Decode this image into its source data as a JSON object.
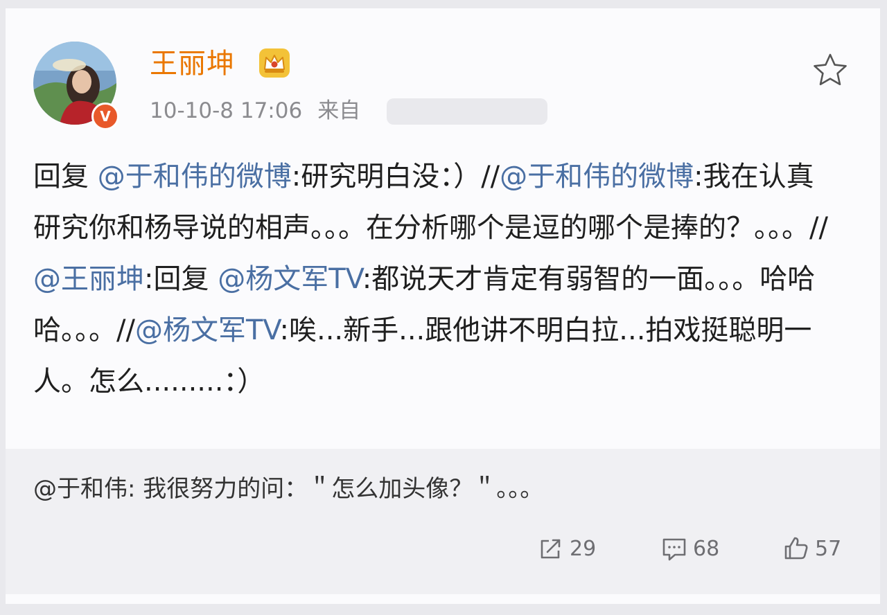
{
  "post": {
    "author": "王丽坤",
    "verified_mark": "V",
    "timestamp": "10-10-8 17:06",
    "source_label": "来自",
    "body": [
      {
        "text": "回复 ",
        "mention": false
      },
      {
        "text": "@于和伟的微博",
        "mention": true
      },
      {
        "text": ":研究明白没：）//",
        "mention": false
      },
      {
        "text": "@于和伟的微博",
        "mention": true
      },
      {
        "text": ":我在认真研究你和杨导说的相声。。。在分析哪个是逗的哪个是捧的？。。。//",
        "mention": false
      },
      {
        "text": "@王丽坤",
        "mention": true
      },
      {
        "text": ":回复 ",
        "mention": false
      },
      {
        "text": "@杨文军TV",
        "mention": true
      },
      {
        "text": ":都说天才肯定有弱智的一面。。。哈哈哈。。。//",
        "mention": false
      },
      {
        "text": "@杨文军TV",
        "mention": true
      },
      {
        "text": ":唉...新手...跟他讲不明白拉...拍戏挺聪明一人。怎么.........：）",
        "mention": false
      }
    ]
  },
  "comment": {
    "text": "@于和伟: 我很努力的问：＂怎么加头像？＂。。。"
  },
  "actions": {
    "repost_count": "29",
    "comment_count": "68",
    "like_count": "57"
  },
  "colors": {
    "username": "#ea7700",
    "mention": "#4a6fa3",
    "verified_badge": "#e8592a",
    "meta": "#8b8b8f"
  },
  "icons": {
    "favorite": "star-icon",
    "vip": "crown-icon",
    "repost": "repost-icon",
    "comment": "comment-icon",
    "like": "thumbs-up-icon"
  }
}
